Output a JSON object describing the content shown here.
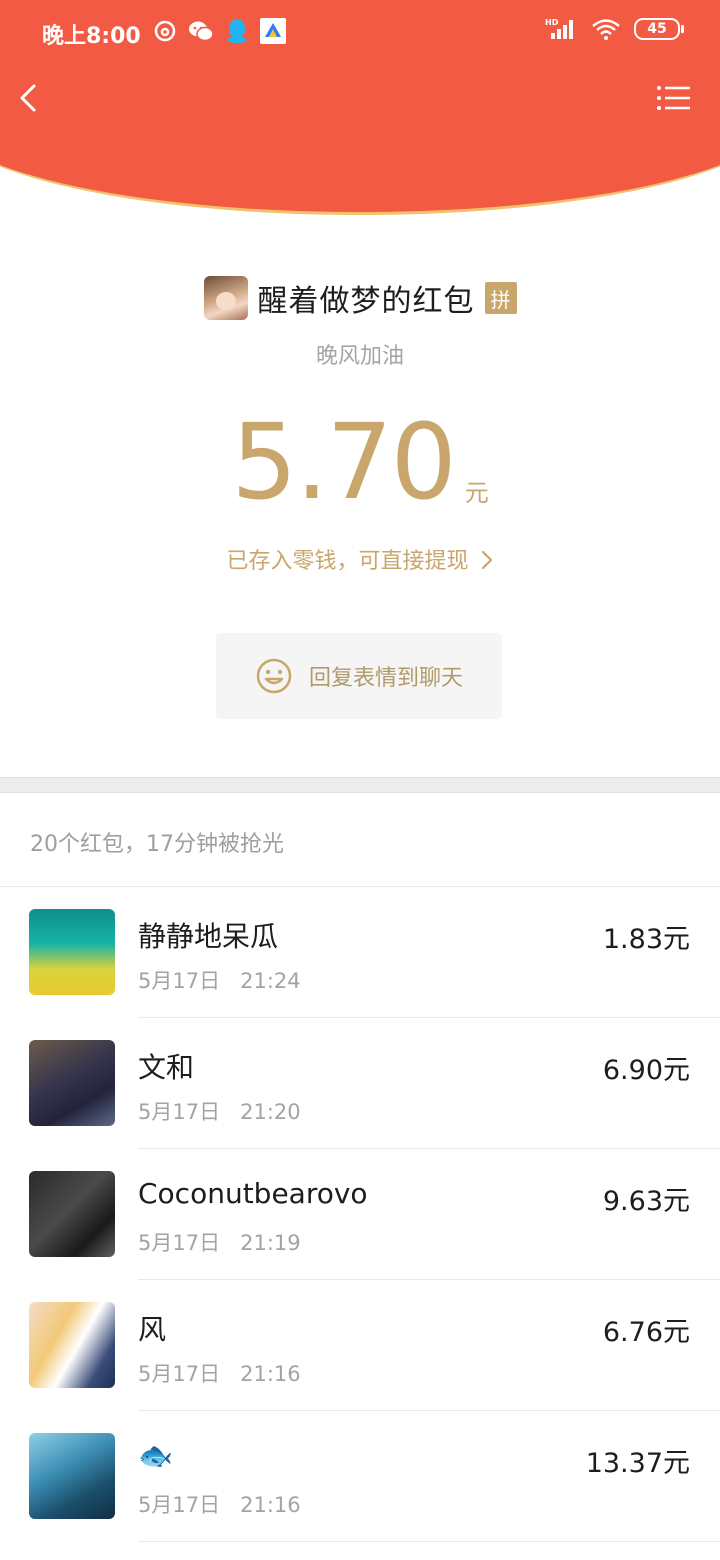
{
  "status_bar": {
    "time": "晚上8:00",
    "battery": "45",
    "network": "HD"
  },
  "nav": {
    "back_icon": "chevron-left-icon",
    "menu_icon": "list-menu-icon"
  },
  "packet": {
    "title": "醒着做梦的红包",
    "badge": "拼",
    "subtitle": "晚风加油",
    "amount": "5.70",
    "unit": "元",
    "stored_text": "已存入零钱，可直接提现",
    "reply_label": "回复表情到聊天"
  },
  "summary": "20个红包，17分钟被抢光",
  "receivers": [
    {
      "name": "静静地呆瓜",
      "time": "5月17日   21:24",
      "amount": "1.83元"
    },
    {
      "name": "文和",
      "time": "5月17日   21:20",
      "amount": "6.90元"
    },
    {
      "name": "Coconutbearovo",
      "time": "5月17日   21:19",
      "amount": "9.63元"
    },
    {
      "name": "风",
      "time": "5月17日   21:16",
      "amount": "6.76元"
    },
    {
      "name": "🐟",
      "time": "5月17日   21:16",
      "amount": "13.37元"
    }
  ],
  "colors": {
    "header_red": "#f25a43",
    "gold": "#c9a66b",
    "arc_border": "#f1c16c"
  }
}
